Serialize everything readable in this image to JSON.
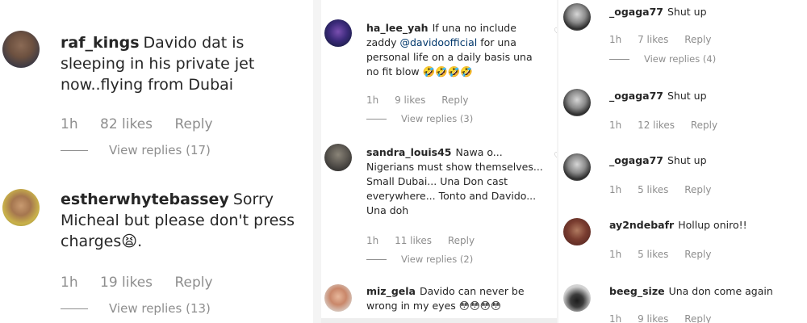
{
  "panel_left": {
    "comments": [
      {
        "username": "raf_kings",
        "text": "Davido dat is sleeping in his private jet now..flying from Dubai",
        "time": "1h",
        "likes": "82 likes",
        "reply": "Reply",
        "view_replies": "View replies (17)"
      },
      {
        "username": "estherwhytebassey",
        "text": "Sorry Micheal but please don't press charges😫.",
        "time": "1h",
        "likes": "19 likes",
        "reply": "Reply",
        "view_replies": "View replies (13)"
      }
    ]
  },
  "panel_middle": {
    "comments": [
      {
        "username": "ha_lee_yah",
        "text_before": "If una no include zaddy ",
        "mention": "@davidoofficial",
        "text_after": " for una personal life on a daily basis una no fit blow 🤣🤣🤣🤣",
        "time": "1h",
        "likes": "9 likes",
        "reply": "Reply",
        "view_replies": "View replies (3)"
      },
      {
        "username": "sandra_louis45",
        "text": "Nawa o... Nigerians must show themselves... Small Dubai... Una Don cast everywhere... Tonto and Davido... Una doh",
        "time": "1h",
        "likes": "11 likes",
        "reply": "Reply",
        "view_replies": "View replies (2)"
      },
      {
        "username": "miz_gela",
        "text": "Davido can never be wrong in my eyes 😳😳😳😳"
      }
    ]
  },
  "panel_right": {
    "comments": [
      {
        "username": "_ogaga77",
        "text": "Shut up",
        "time": "1h",
        "likes": "7 likes",
        "reply": "Reply",
        "view_replies": "View replies (4)"
      },
      {
        "username": "_ogaga77",
        "text": "Shut up",
        "time": "1h",
        "likes": "12 likes",
        "reply": "Reply"
      },
      {
        "username": "_ogaga77",
        "text": "Shut up",
        "time": "1h",
        "likes": "5 likes",
        "reply": "Reply"
      },
      {
        "username": "ay2ndebafr",
        "text": "Hollup oniro!!",
        "time": "1h",
        "likes": "5 likes",
        "reply": "Reply"
      },
      {
        "username": "beeg_size",
        "text": "Una don come again",
        "time": "1h",
        "likes": "9 likes",
        "reply": "Reply"
      }
    ]
  },
  "colors": {
    "username": "#262626",
    "meta": "#8e8e8e",
    "mention": "#00376b"
  },
  "icons": [
    "heart-icon"
  ]
}
